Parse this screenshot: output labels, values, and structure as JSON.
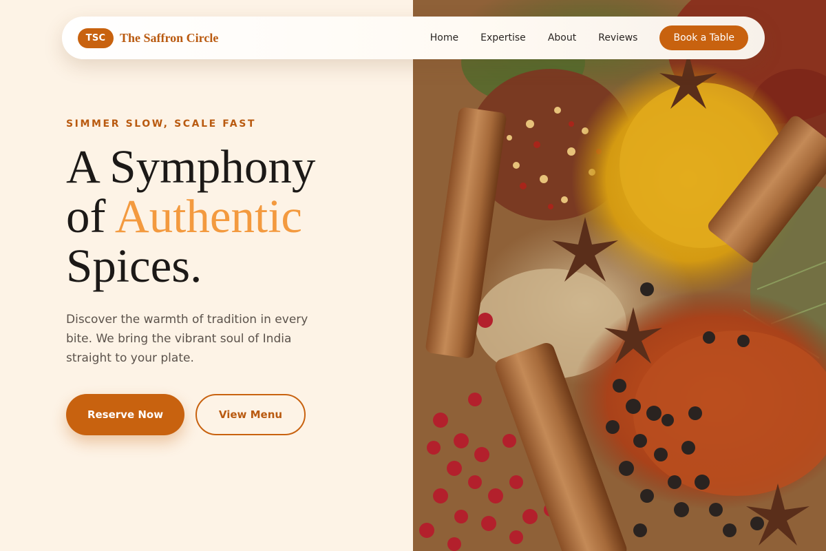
{
  "brand": {
    "badge": "TSC",
    "name": "The Saffron Circle"
  },
  "nav": {
    "links": [
      "Home",
      "Expertise",
      "About",
      "Reviews"
    ],
    "cta": "Book a Table"
  },
  "hero": {
    "eyebrow": "SIMMER SLOW, SCALE FAST",
    "headline_line1": "A Symphony",
    "headline_of": "of ",
    "headline_accent": "Authentic",
    "headline_line3": "Spices.",
    "lede": "Discover the warmth of tradition in every bite. We bring the vibrant soul of India straight to your plate.",
    "primary_cta": "Reserve Now",
    "secondary_cta": "View Menu"
  },
  "colors": {
    "background": "#fdf3e6",
    "accent": "#c8620f",
    "accent_text": "#b95a10",
    "headline_accent": "#f39a3f",
    "headline": "#1c1917"
  },
  "image": {
    "subject": "spices-photo"
  }
}
